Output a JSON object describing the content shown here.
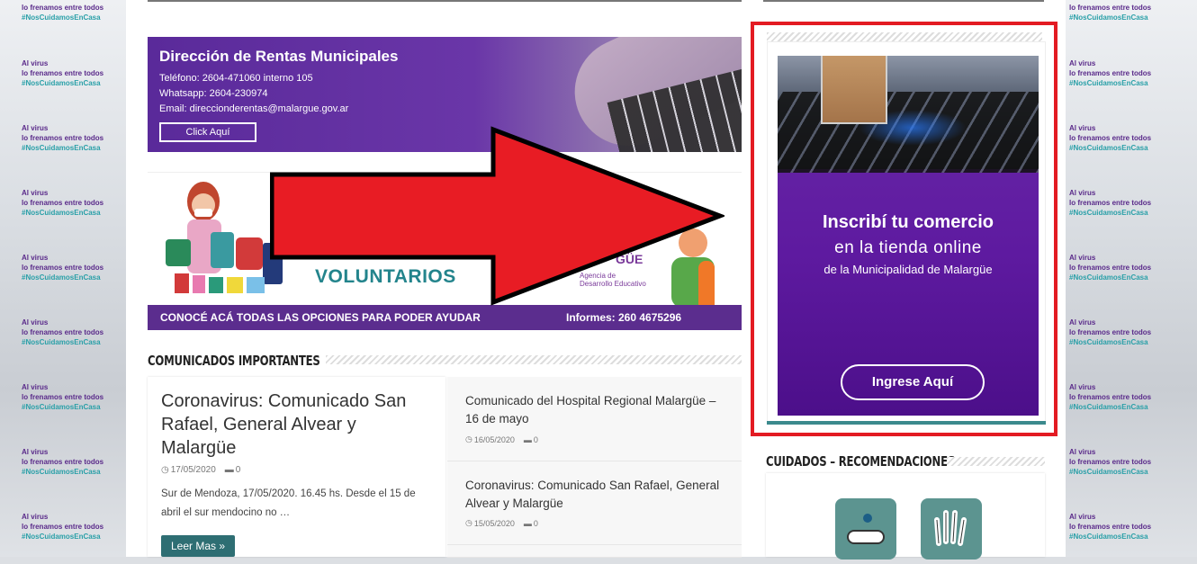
{
  "background_text": {
    "l1": "Al virus",
    "l2a": "lo frenamos entre ",
    "l2b": "todos",
    "l3": "#NosCuidamosEnCasa",
    "top_l2": "lo frenamos entre todos"
  },
  "rentas": {
    "title": "Dirección de Rentas Municipales",
    "phone": "Teléfono: 2604-471060 interno 105",
    "whatsapp": "Whatsapp: 2604-230974",
    "email": "Email: direccionderentas@malargue.gov.ar",
    "button": "Click Aquí"
  },
  "voluntarios": {
    "title": "VOLUNTARIOS",
    "agency": "Agencia de\nDesarrollo Educativo",
    "brand_fragment": "GÜE",
    "bottom_text": "CONOCÉ ACÁ TODAS LAS OPCIONES PARA PODER AYUDAR",
    "info": "Informes: 260 4675296"
  },
  "comunicados": {
    "section_title": "COMUNICADOS IMPORTANTES",
    "featured": {
      "title": "Coronavirus: Comunicado San Rafael, General Alvear y Malargüe",
      "date": "17/05/2020",
      "comments": "0",
      "excerpt": "Sur de Mendoza, 17/05/2020. 16.45 hs. Desde el 15 de abril el sur mendocino no …",
      "read_more": "Leer Mas »"
    },
    "items": [
      {
        "title": "Comunicado del Hospital Regional Malargüe – 16 de mayo",
        "date": "16/05/2020",
        "comments": "0"
      },
      {
        "title": "Coronavirus: Comunicado San Rafael, General Alvear y Malargüe",
        "date": "15/05/2020",
        "comments": "0"
      }
    ]
  },
  "ad": {
    "line1": "Inscribí tu comercio",
    "line2": "en la tienda online",
    "line3": "de la Municipalidad de Malargüe",
    "button": "Ingrese Aquí"
  },
  "cuidados": {
    "section_title": "CUIDADOS – RECOMENDACIONES"
  },
  "colors": {
    "purple": "#5b2d8e",
    "teal": "#2e6e73",
    "highlight_red": "#e31b23",
    "arrow_red": "#e81c24"
  }
}
